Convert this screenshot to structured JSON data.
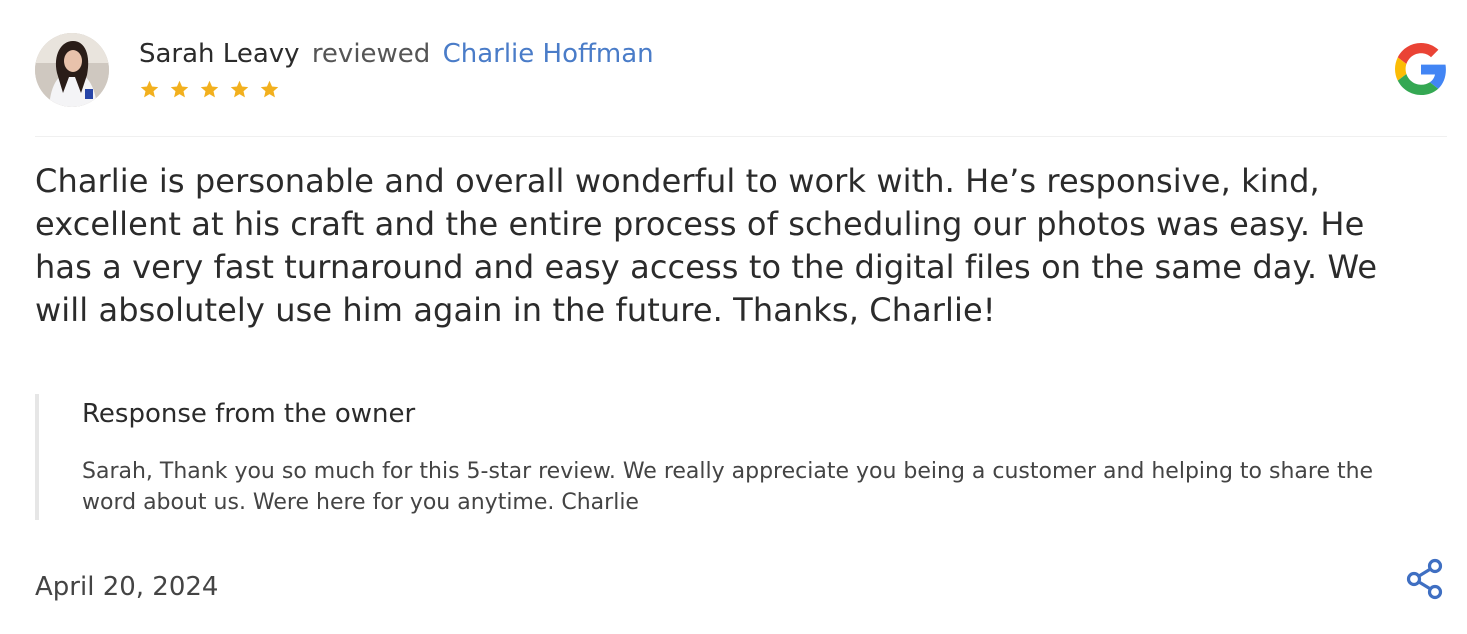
{
  "review": {
    "reviewer_name": "Sarah Leavy",
    "reviewed_word": "reviewed",
    "business_name": "Charlie Hoffman",
    "rating": 5,
    "star_color": "#f2b01e",
    "link_color": "#4a7cc8",
    "text": "Charlie is personable and overall wonderful to work with. He’s responsive, kind, excellent at his craft and the entire process of scheduling our photos was easy. He has a very fast turnaround and easy access to the digital files on the same day. We will absolutely use him again in the future. Thanks, Charlie!",
    "date": "April 20, 2024"
  },
  "owner_response": {
    "title": "Response from the owner",
    "text": "Sarah, Thank you so much for this 5-star review. We really appreciate you being a customer and helping to share the word about us. Were here for you anytime. Charlie"
  },
  "icons": {
    "source": "google-logo-icon",
    "share": "share-icon",
    "star": "star-icon"
  }
}
